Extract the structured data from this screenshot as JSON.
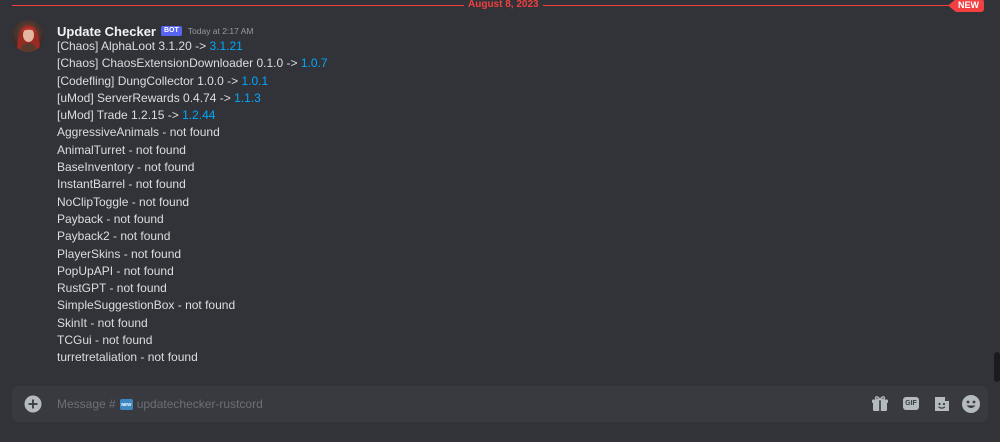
{
  "divider": {
    "date": "August 8, 2023",
    "new_label": "NEW"
  },
  "message": {
    "username": "Update Checker",
    "bot_tag": "BOT",
    "timestamp": "Today at 2:17 AM",
    "lines": [
      {
        "text": "[Chaos] AlphaLoot 3.1.20 -> ",
        "link": "3.1.21"
      },
      {
        "text": "[Chaos] ChaosExtensionDownloader 0.1.0 -> ",
        "link": "1.0.7"
      },
      {
        "text": "[Codefling] DungCollector 1.0.0 -> ",
        "link": "1.0.1"
      },
      {
        "text": "[uMod] ServerRewards 0.4.74 -> ",
        "link": "1.1.3"
      },
      {
        "text": "[uMod] Trade 1.2.15 -> ",
        "link": "1.2.44"
      },
      {
        "text": "AggressiveAnimals - not found"
      },
      {
        "text": "AnimalTurret - not found"
      },
      {
        "text": "BaseInventory - not found"
      },
      {
        "text": "InstantBarrel - not found"
      },
      {
        "text": "NoClipToggle - not found"
      },
      {
        "text": "Payback - not found"
      },
      {
        "text": "Payback2 - not found"
      },
      {
        "text": "PlayerSkins - not found"
      },
      {
        "text": "PopUpAPI - not found"
      },
      {
        "text": "RustGPT - not found"
      },
      {
        "text": "SimpleSuggestionBox - not found"
      },
      {
        "text": "SkinIt - not found"
      },
      {
        "text": "TCGui - not found"
      },
      {
        "text": "turretretaliation - not found"
      }
    ]
  },
  "composer": {
    "placeholder_prefix": "Message #",
    "channel_emoji": "NEW",
    "channel_name": "updatechecker-rustcord",
    "gif_label": "GIF"
  },
  "icons": {
    "add": "plus-circle-icon",
    "gift": "gift-icon",
    "gif": "gif-icon",
    "sticker": "sticker-icon",
    "emoji": "smiley-icon"
  },
  "colors": {
    "background": "#313338",
    "accent_red": "#f23f42",
    "link": "#00a8fc",
    "bot_tag": "#5865f2",
    "composer_bg": "#383a40"
  }
}
